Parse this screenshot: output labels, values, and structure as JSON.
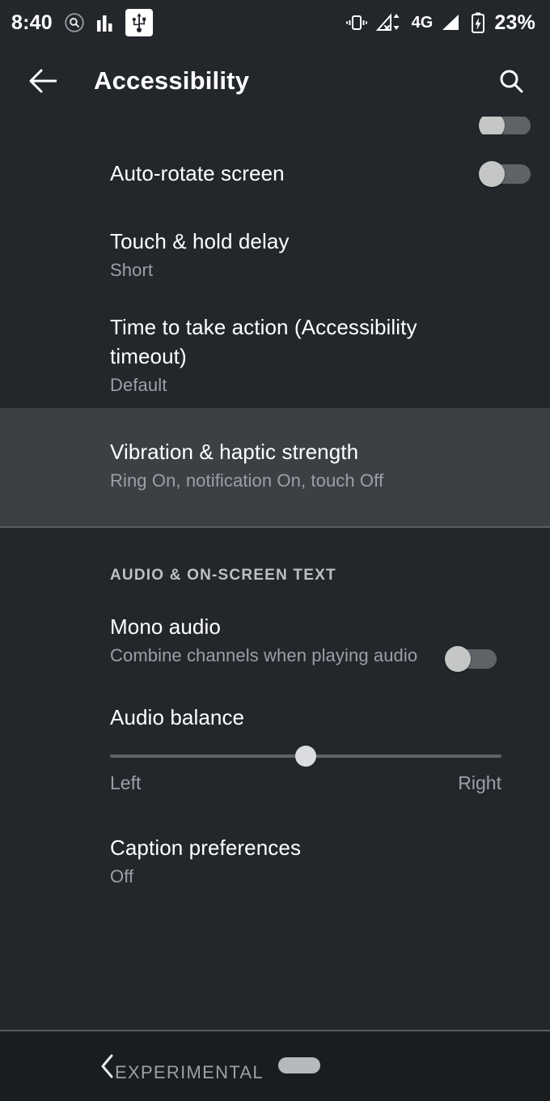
{
  "status_bar": {
    "time": "8:40",
    "battery_percent": "23%",
    "network_label": "4G",
    "icons": [
      {
        "name": "magnifier-circle-icon"
      },
      {
        "name": "bar-chart-icon"
      },
      {
        "name": "usb-icon"
      },
      {
        "name": "vibrate-icon"
      },
      {
        "name": "no-signal-data-icon"
      },
      {
        "name": "signal-bars-icon"
      },
      {
        "name": "battery-charging-icon"
      }
    ]
  },
  "header": {
    "title": "Accessibility",
    "back_icon": "arrow-left-icon",
    "search_icon": "search-icon"
  },
  "list": {
    "items": [
      {
        "id": "partial-top-toggle",
        "title": "",
        "subtitle": "",
        "control": "switch",
        "switch_state": "off",
        "partial": true
      },
      {
        "id": "auto-rotate-screen",
        "title": "Auto-rotate screen",
        "subtitle": "",
        "control": "switch",
        "switch_state": "off"
      },
      {
        "id": "touch-and-hold-delay",
        "title": "Touch & hold delay",
        "subtitle": "Short",
        "control": "none"
      },
      {
        "id": "accessibility-timeout",
        "title": "Time to take action (Accessibility timeout)",
        "subtitle": "Default",
        "control": "none"
      },
      {
        "id": "vibration-haptic-strength",
        "title": "Vibration & haptic strength",
        "subtitle": "Ring On, notification On, touch Off",
        "control": "none",
        "highlighted": true
      }
    ],
    "section_header": "AUDIO & ON-SCREEN TEXT",
    "audio_items": [
      {
        "id": "mono-audio",
        "title": "Mono audio",
        "subtitle": "Combine channels when playing audio",
        "control": "switch",
        "switch_state": "off"
      },
      {
        "id": "caption-preferences",
        "title": "Caption preferences",
        "subtitle": "Off",
        "control": "none"
      }
    ],
    "audio_balance": {
      "title": "Audio balance",
      "left_label": "Left",
      "right_label": "Right",
      "value_percent": 50
    }
  },
  "nav_bar": {
    "back_icon": "chevron-left-icon",
    "label": "EXPERIMENTAL",
    "home_indicator": "home-pill-indicator"
  },
  "colors": {
    "background": "#23272b",
    "highlight_row": "#3c4044",
    "nav_background": "#1a1d20",
    "primary_text": "#ffffff",
    "secondary_text": "#9aa0a6",
    "switch_track": "#5f6368",
    "switch_thumb": "#c4c7c5"
  }
}
